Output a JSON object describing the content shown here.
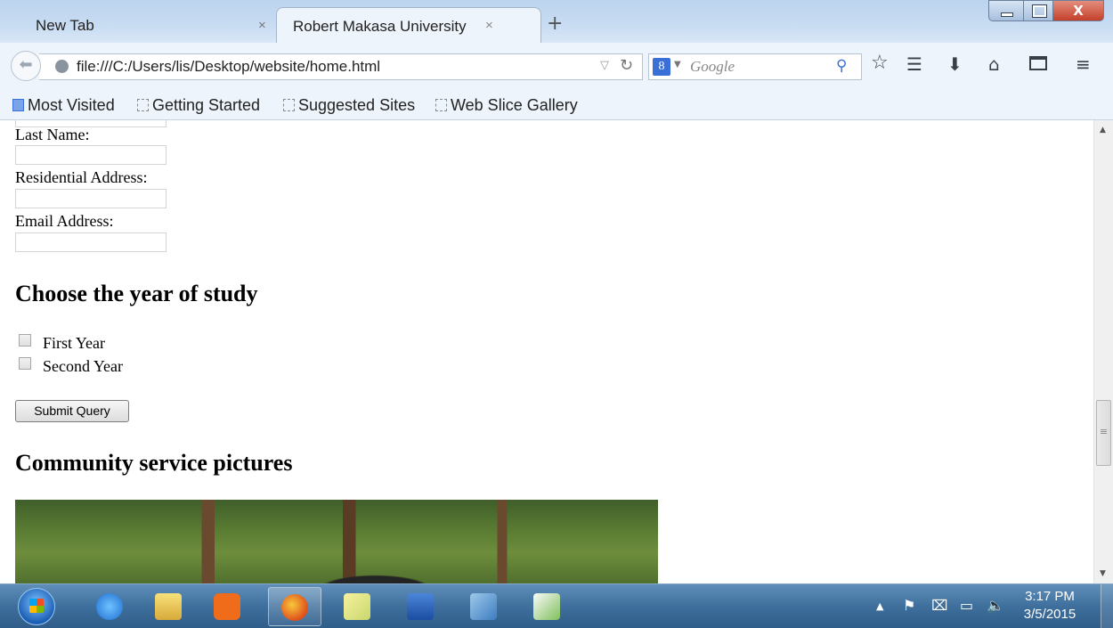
{
  "browser": {
    "tabs": [
      {
        "label": "New Tab",
        "close": "×"
      },
      {
        "label": "Robert Makasa University",
        "close": "×"
      }
    ],
    "new_tab_glyph": "+",
    "close_window_glyph": "X",
    "url": "file:///C:/Users/lis/Desktop/website/home.html",
    "search_placeholder": "Google",
    "search_engine_glyph": "8",
    "bookmarks": [
      "Most Visited",
      "Getting Started",
      "Suggested Sites",
      "Web Slice Gallery"
    ],
    "icons": [
      "back-arrow-icon",
      "globe-icon",
      "reload-icon",
      "google-icon",
      "search-go-icon",
      "star-icon",
      "bookmarks-icon",
      "download-icon",
      "home-icon",
      "panel-icon",
      "menu-icon"
    ]
  },
  "form": {
    "last_name_label": "Last Name:",
    "address_label": "Residential Address:",
    "email_label": "Email Address:",
    "year_heading": "Choose the year of study",
    "options": [
      {
        "label": "First Year",
        "checked": false
      },
      {
        "label": "Second Year",
        "checked": false
      }
    ],
    "submit_label": "Submit Query"
  },
  "pictures": {
    "heading": "Community service pictures"
  },
  "taskbar": {
    "apps": [
      "internet-explorer",
      "file-explorer",
      "media-player",
      "firefox",
      "sticky-notes",
      "word",
      "notepad",
      "paint"
    ],
    "active_app": "firefox",
    "time": "3:17 PM",
    "date": "3/5/2015"
  },
  "colors": {
    "taskbar": "#3f6f9c",
    "chrome_bg": "#eef4fb",
    "close_button": "#c4402a"
  }
}
